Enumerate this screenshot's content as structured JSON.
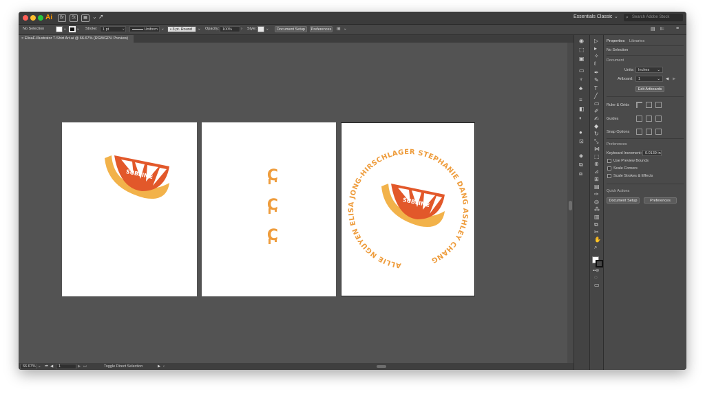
{
  "app": {
    "logo": "Ai",
    "workspace": "Essentials Classic",
    "search_placeholder": "Search Adobe Stock"
  },
  "controlbar": {
    "selection": "No Selection",
    "stroke_label": "Stroke:",
    "stroke_value": "1 pt",
    "uniform_label": "Uniform",
    "brush_label": "3 pt. Round",
    "opacity_label": "Opacity:",
    "opacity_value": "100%",
    "style_label": "Style:",
    "document_setup": "Document Setup",
    "preferences": "Preferences"
  },
  "document": {
    "tab_title": "ElisaF-Illustrator T-Shirt Art.ai @ 66.67% (RGB/GPU Preview)"
  },
  "artwork": {
    "ribbon_text": "SUBLIME",
    "letter": "C",
    "circle_text": "ALLIE NGUYEN   ELISA JONG-HIRSCHLAGER   STEPHANIE DANG   ASHLEY CHANG",
    "colors": {
      "orange": "#f0a040",
      "deep_orange": "#e05a28",
      "light_orange": "#f6b84e",
      "drip_orange": "#ee9c3c"
    }
  },
  "statusbar": {
    "zoom": "66.67%",
    "artboard_num": "1",
    "tool_hint": "Toggle Direct Selection"
  },
  "properties": {
    "tab_properties": "Properties",
    "tab_libraries": "Libraries",
    "no_selection": "No Selection",
    "document_head": "Document",
    "units_label": "Units:",
    "units_value": "Inches",
    "artboard_label": "Artboard:",
    "artboard_value": "1",
    "edit_artboards": "Edit Artboards",
    "ruler_grids": "Ruler & Grids",
    "guides": "Guides",
    "snap_options": "Snap Options",
    "preferences_head": "Preferences",
    "keyboard_increment_label": "Keyboard Increment:",
    "keyboard_increment_value": "0.0139 in",
    "use_preview_bounds": "Use Preview Bounds",
    "scale_corners": "Scale Corners",
    "scale_strokes": "Scale Strokes & Effects",
    "quick_actions": "Quick Actions",
    "document_setup_btn": "Document Setup",
    "preferences_btn": "Preferences"
  }
}
